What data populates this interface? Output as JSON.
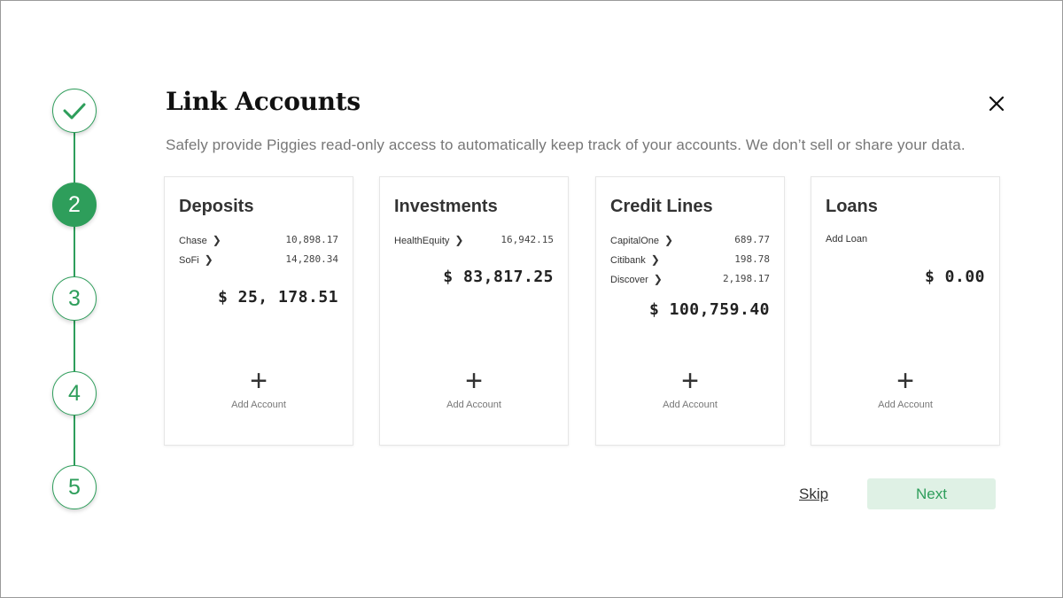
{
  "stepper": {
    "steps": [
      {
        "label": "",
        "state": "done",
        "icon": "check-icon"
      },
      {
        "label": "2",
        "state": "active"
      },
      {
        "label": "3",
        "state": "pending"
      },
      {
        "label": "4",
        "state": "pending"
      },
      {
        "label": "5",
        "state": "pending"
      }
    ],
    "accent": "#2e9e5b"
  },
  "header": {
    "title": "Link Accounts",
    "subtitle": "Safely provide Piggies read-only access to automatically keep track of your accounts. We don’t sell or share your data.",
    "close_icon": "close-icon"
  },
  "cards": [
    {
      "title": "Deposits",
      "accounts": [
        {
          "name": "Chase",
          "amount": "10,898.17"
        },
        {
          "name": "SoFi",
          "amount": "14,280.34"
        }
      ],
      "total": "$ 25, 178.51",
      "add_label": "Add Account"
    },
    {
      "title": "Investments",
      "accounts": [
        {
          "name": "HealthEquity",
          "amount": "16,942.15"
        }
      ],
      "total": "$ 83,817.25",
      "add_label": "Add Account"
    },
    {
      "title": "Credit Lines",
      "accounts": [
        {
          "name": "CapitalOne",
          "amount": "689.77"
        },
        {
          "name": "Citibank",
          "amount": "198.78"
        },
        {
          "name": "Discover",
          "amount": "2,198.17"
        }
      ],
      "total": "$ 100,759.40",
      "add_label": "Add Account"
    },
    {
      "title": "Loans",
      "add_loan": "Add Loan",
      "total": "$ 0.00",
      "add_label": "Add Account"
    }
  ],
  "footer": {
    "skip_label": "Skip",
    "next_label": "Next",
    "next_bg": "#dff1e5"
  }
}
